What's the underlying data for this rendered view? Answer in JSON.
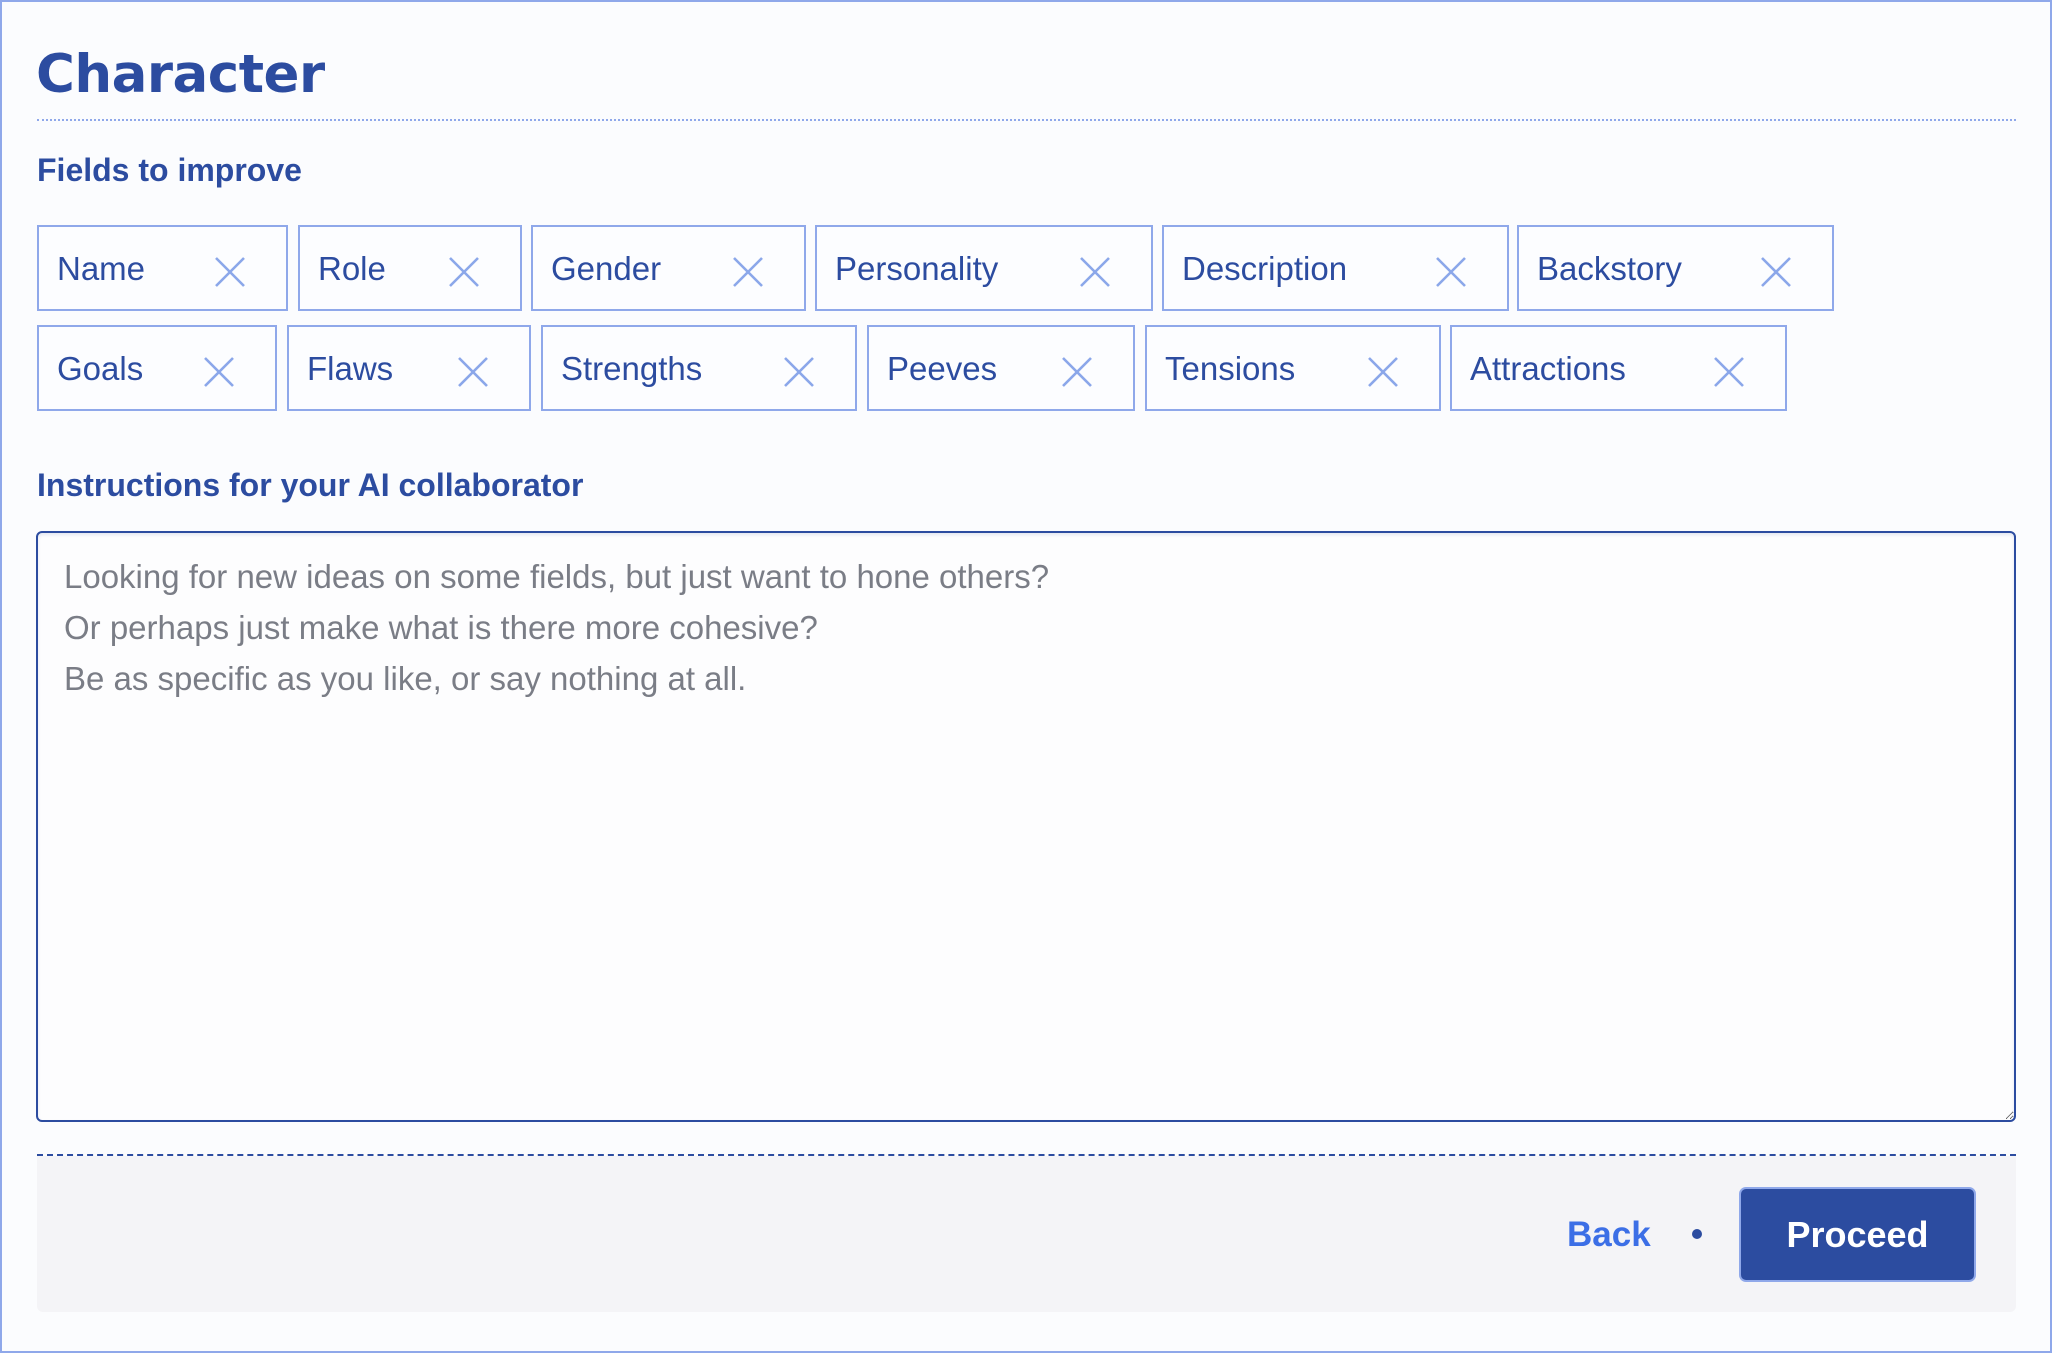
{
  "header": {
    "title": "Character"
  },
  "fields_section": {
    "label": "Fields to improve",
    "chips": [
      {
        "label": "Name",
        "remove_icon": "close-icon"
      },
      {
        "label": "Role",
        "remove_icon": "close-icon"
      },
      {
        "label": "Gender",
        "remove_icon": "close-icon"
      },
      {
        "label": "Personality",
        "remove_icon": "close-icon"
      },
      {
        "label": "Description",
        "remove_icon": "close-icon"
      },
      {
        "label": "Backstory",
        "remove_icon": "close-icon"
      },
      {
        "label": "Goals",
        "remove_icon": "close-icon"
      },
      {
        "label": "Flaws",
        "remove_icon": "close-icon"
      },
      {
        "label": "Strengths",
        "remove_icon": "close-icon"
      },
      {
        "label": "Peeves",
        "remove_icon": "close-icon"
      },
      {
        "label": "Tensions",
        "remove_icon": "close-icon"
      },
      {
        "label": "Attractions",
        "remove_icon": "close-icon"
      }
    ]
  },
  "instructions_section": {
    "label": "Instructions for your AI collaborator",
    "value": "",
    "placeholder": "Looking for new ideas on some fields, but just want to hone others?\nOr perhaps just make what is there more cohesive?\nBe as specific as you like, or say nothing at all."
  },
  "footer": {
    "back_label": "Back",
    "separator": "•",
    "proceed_label": "Proceed"
  },
  "colors": {
    "primary": "#2c4ca0",
    "link": "#3c6fe6",
    "border_light": "#8fa8ea",
    "footer_bg": "#f4f4f7",
    "placeholder": "#7a7d86"
  }
}
